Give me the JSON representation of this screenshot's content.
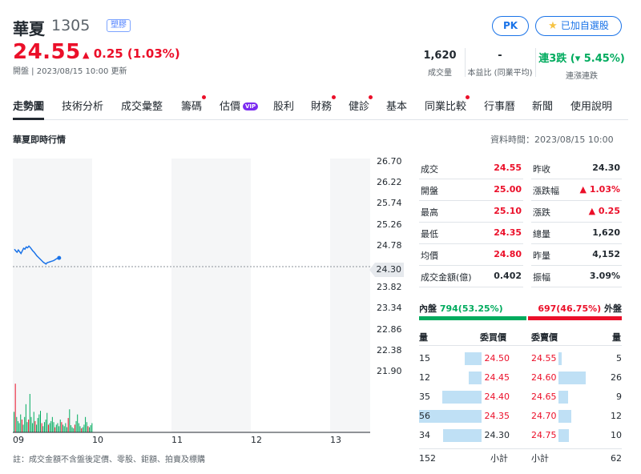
{
  "header": {
    "name": "華夏",
    "code": "1305",
    "sector": "塑膠",
    "price": "24.55",
    "change": "0.25 (1.03%)",
    "update_info": "開盤 | 2023/08/15 10:00 更新",
    "pk_label": "PK",
    "watch_label": "已加自選股",
    "stats": [
      {
        "value": "1,620",
        "label": "成交量"
      },
      {
        "value": "-",
        "label": "本益比 (同業平均)"
      },
      {
        "value": "連3跌 (▾ 5.45%)",
        "label": "連漲連跌"
      }
    ]
  },
  "tabs": [
    "走勢圖",
    "技術分析",
    "成交彙整",
    "籌碼",
    "估價",
    "股利",
    "財務",
    "健診",
    "基本",
    "同業比較",
    "行事曆",
    "新聞",
    "使用說明"
  ],
  "vip_label": "VIP",
  "section_title": "華夏即時行情",
  "data_time": "資料時間：2023/08/15 10:00",
  "chart_data": {
    "type": "line",
    "y_ticks": [
      "26.70",
      "26.22",
      "25.74",
      "25.26",
      "24.78",
      "24.30",
      "23.82",
      "23.34",
      "22.86",
      "22.38",
      "21.90"
    ],
    "ylim": [
      21.9,
      26.7
    ],
    "prev_close": 24.3,
    "prev_close_label": "24.30",
    "x_ticks": [
      "09",
      "10",
      "11",
      "12",
      "13"
    ],
    "series": [
      {
        "values": [
          24.7,
          24.66,
          24.63,
          24.68,
          24.64,
          24.6,
          24.66,
          24.72,
          24.7,
          24.75,
          24.73,
          24.77,
          24.74,
          24.7,
          24.66,
          24.63,
          24.59,
          24.55,
          24.52,
          24.49,
          24.46,
          24.43,
          24.4,
          24.38,
          24.36,
          24.39,
          24.4,
          24.41,
          24.42,
          24.43,
          24.44,
          24.46,
          24.48,
          24.49,
          24.5
        ]
      }
    ],
    "volumes": [
      0.4,
      0.95,
      0.3,
      0.22,
      0.18,
      0.35,
      0.25,
      0.15,
      0.3,
      0.55,
      0.2,
      0.25,
      0.75,
      0.3,
      0.18,
      0.4,
      0.22,
      0.15,
      0.28,
      0.35,
      0.42,
      0.18,
      0.12,
      0.2,
      0.25,
      0.38,
      0.15,
      0.18,
      0.22,
      0.3,
      0.2,
      0.1,
      0.15,
      0.18,
      0.12,
      0.25,
      0.2,
      0.15,
      0.12,
      0.18,
      0.1,
      0.28,
      0.45,
      0.14,
      0.1,
      0.08,
      0.15,
      0.22,
      0.35,
      0.18,
      0.12,
      0.08,
      0.1,
      0.15,
      0.3,
      0.2,
      0.12,
      0.1,
      0.14,
      0.18
    ]
  },
  "quote_table": [
    {
      "l1": "成交",
      "v1": "24.55",
      "c1": "red",
      "l2": "昨收",
      "v2": "24.30",
      "c2": ""
    },
    {
      "l1": "開盤",
      "v1": "25.00",
      "c1": "red",
      "l2": "漲跌幅",
      "v2": "▲ 1.03%",
      "c2": "red"
    },
    {
      "l1": "最高",
      "v1": "25.10",
      "c1": "red",
      "l2": "漲跌",
      "v2": "▲ 0.25",
      "c2": "red"
    },
    {
      "l1": "最低",
      "v1": "24.35",
      "c1": "red",
      "l2": "總量",
      "v2": "1,620",
      "c2": ""
    },
    {
      "l1": "均價",
      "v1": "24.80",
      "c1": "red",
      "l2": "昨量",
      "v2": "4,152",
      "c2": ""
    },
    {
      "l1": "成交金額(億)",
      "v1": "0.402",
      "c1": "",
      "l2": "振幅",
      "v2": "3.09%",
      "c2": ""
    }
  ],
  "inout": {
    "inner_label": "內盤",
    "inner_value": "794(53.25%)",
    "outer_value": "697(46.75%)",
    "outer_label": "外盤",
    "inner_pct": 53.25
  },
  "order_book": {
    "headers": {
      "bid_vol": "量",
      "bid_price": "委買價",
      "ask_price": "委賣價",
      "ask_vol": "量"
    },
    "rows": [
      {
        "bid_vol": "15",
        "bid": "24.50",
        "bid_c": "red",
        "bid_frac": 0.27,
        "ask": "24.55",
        "ask_c": "red",
        "ask_frac": 0.05,
        "ask_vol": "5"
      },
      {
        "bid_vol": "12",
        "bid": "24.45",
        "bid_c": "red",
        "bid_frac": 0.21,
        "ask": "24.60",
        "ask_c": "red",
        "ask_frac": 0.46,
        "ask_vol": "26"
      },
      {
        "bid_vol": "35",
        "bid": "24.40",
        "bid_c": "red",
        "bid_frac": 0.63,
        "ask": "24.65",
        "ask_c": "red",
        "ask_frac": 0.16,
        "ask_vol": "9"
      },
      {
        "bid_vol": "56",
        "bid": "24.35",
        "bid_c": "red",
        "bid_frac": 1.0,
        "ask": "24.70",
        "ask_c": "red",
        "ask_frac": 0.21,
        "ask_vol": "12"
      },
      {
        "bid_vol": "34",
        "bid": "24.30",
        "bid_c": "",
        "bid_frac": 0.61,
        "ask": "24.75",
        "ask_c": "red",
        "ask_frac": 0.18,
        "ask_vol": "10"
      }
    ],
    "total_bid": "152",
    "subtotal_label": "小計",
    "total_ask": "62"
  },
  "footnote": "註：成交金額不含盤後定價、零股、鉅額、拍賣及標購"
}
